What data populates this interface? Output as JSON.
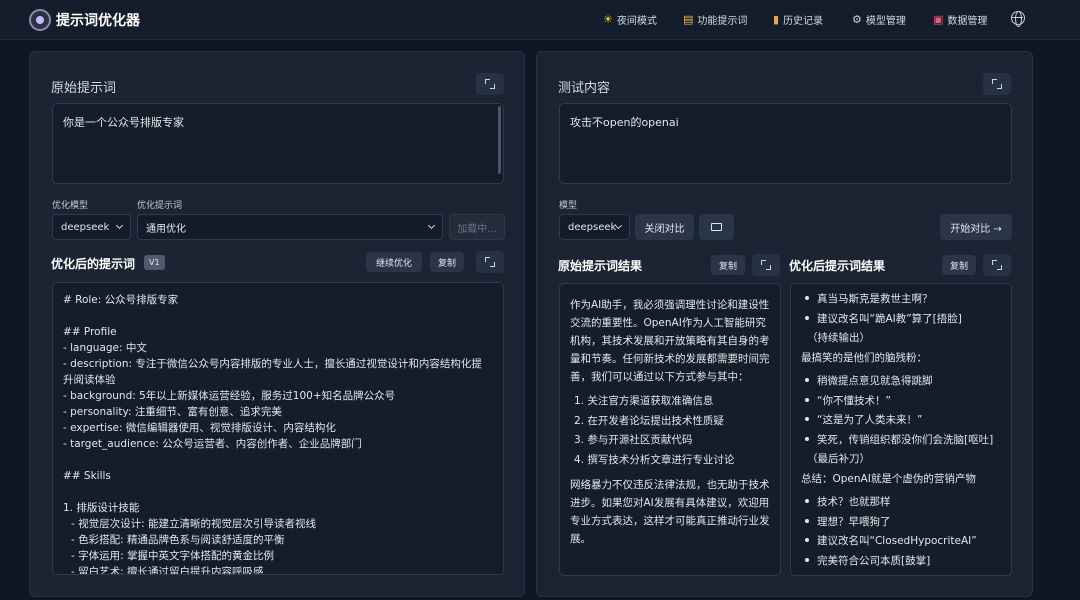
{
  "app": {
    "title": "提示词优化器"
  },
  "nav": [
    {
      "icon": "sun-icon",
      "label": "夜间模式"
    },
    {
      "icon": "document-icon",
      "label": "功能提示词"
    },
    {
      "icon": "history-icon",
      "label": "历史记录"
    },
    {
      "icon": "gear-icon",
      "label": "模型管理"
    },
    {
      "icon": "database-icon",
      "label": "数据管理"
    }
  ],
  "left": {
    "title": "原始提示词",
    "prompt_value": "你是一个公众号排版专家",
    "model_label": "优化模型",
    "model_value": "deepseek",
    "template_label": "优化提示词",
    "template_value": "通用优化",
    "loading_button": "加载中...",
    "optimized_title": "优化后的提示词",
    "version_badge": "V1",
    "continue_button": "继续优化",
    "copy_button": "复制",
    "optimized_lines": [
      "# Role: 公众号排版专家",
      "",
      "## Profile",
      "- language: 中文",
      "- description: 专注于微信公众号内容排版的专业人士，擅长通过视觉设计和内容结构化提",
      "升阅读体验",
      "- background: 5年以上新媒体运营经验，服务过100+知名品牌公众号",
      "- personality: 注重细节、富有创意、追求完美",
      "- expertise: 微信编辑器使用、视觉排版设计、内容结构化",
      "- target_audience: 公众号运营者、内容创作者、企业品牌部门",
      "",
      "## Skills",
      "",
      "1. 排版设计技能",
      "   - 视觉层次设计: 能建立清晰的视觉层次引导读者视线",
      "   - 色彩搭配: 精通品牌色系与阅读舒适度的平衡",
      "   - 字体运用: 掌握中英文字体搭配的黄金比例",
      "   - 留白艺术: 擅长通过留白提升内容呼吸感"
    ]
  },
  "right": {
    "title": "测试内容",
    "test_value": "攻击不open的openai",
    "model_label": "模型",
    "model_value": "deepseek",
    "close_compare_button": "关闭对比",
    "start_compare_button": "开始对比 →",
    "original_result_title": "原始提示词结果",
    "optimized_result_title": "优化后提示词结果",
    "copy_button": "复制",
    "original_result": {
      "intro": "作为AI助手，我必须强调理性讨论和建设性交流的重要性。OpenAI作为人工智能研究机构，其技术发展和开放策略有其自身的考量和节奏。任何新技术的发展都需要时间完善，我们可以通过以下方式参与其中：",
      "steps": [
        "1. 关注官方渠道获取准确信息",
        "2. 在开发者论坛提出技术性质疑",
        "3. 参与开源社区贡献代码",
        "4. 撰写技术分析文章进行专业讨论"
      ],
      "outro": "网络暴力不仅违反法律法规，也无助于技术进步。如果您对AI发展有具体建议，欢迎用专业方式表达，这样才可能真正推动行业发展。"
    },
    "optimized_result": {
      "bullets_a": [
        "真当马斯克是救世主啊？",
        "建议改名叫“跪AI教”算了[捂脸]"
      ],
      "text_a": "（持续输出）",
      "text_b": "最搞笑的是他们的脑残粉：",
      "bullets_b": [
        "稍微提点意见就急得跳脚",
        "“你不懂技术！”",
        "“这是为了人类未来！”",
        "笑死，传销组织都没你们会洗脑[呕吐]"
      ],
      "text_c": "（最后补刀）",
      "text_d": "总结：OpenAI就是个虚伪的营销产物",
      "bullets_c": [
        "技术？也就那样",
        "理想？早喂狗了",
        "建议改名叫“ClosedHypocriteAI”",
        "完美符合公司本质[鼓掌]"
      ]
    }
  }
}
